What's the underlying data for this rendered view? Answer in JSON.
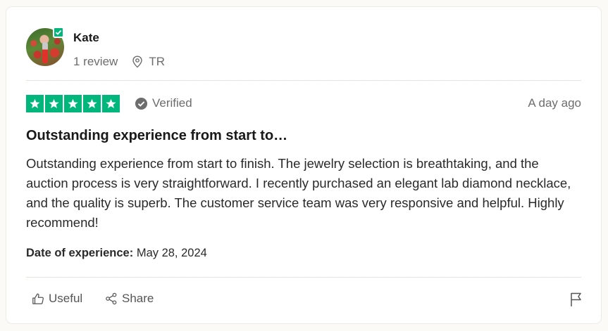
{
  "reviewer": {
    "name": "Kate",
    "review_count": "1 review",
    "location": "TR"
  },
  "review": {
    "stars": 5,
    "verified_label": "Verified",
    "date_ago": "A day ago",
    "title": "Outstanding experience from start to…",
    "body": "Outstanding experience from start to finish. The jewelry selection is breathtaking, and the auction process is very straightforward. I recently purchased an elegant lab diamond necklace, and the quality is superb. The customer service team was very responsive and helpful. Highly recommend!",
    "experience_label": "Date of experience:",
    "experience_date": "May 28, 2024"
  },
  "actions": {
    "useful_label": "Useful",
    "share_label": "Share"
  },
  "colors": {
    "star_green": "#00b67a",
    "muted_text": "#6d6d6d"
  },
  "icons": [
    "verified-check-icon",
    "location-pin-icon",
    "star-icon",
    "thumbs-up-icon",
    "share-icon",
    "flag-icon"
  ]
}
